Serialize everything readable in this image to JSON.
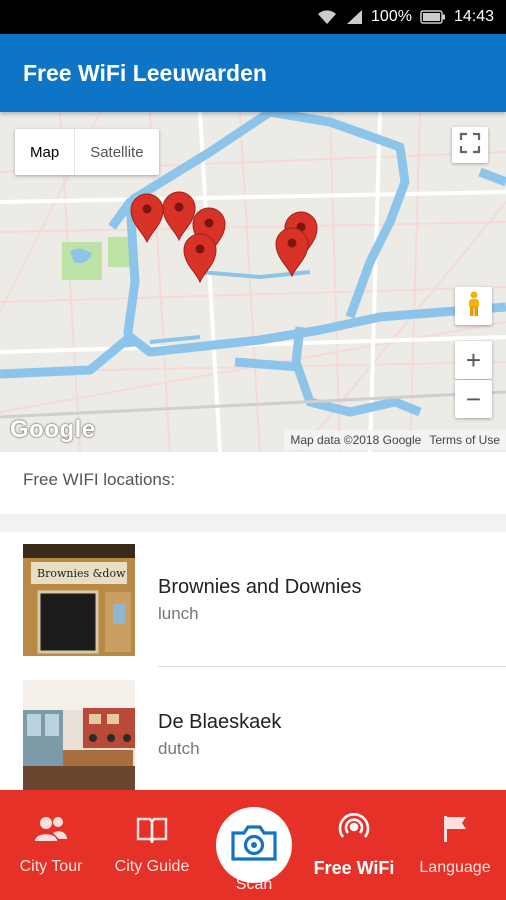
{
  "status_bar": {
    "battery": "100%",
    "time": "14:43",
    "icons": [
      "wifi-icon",
      "signal-icon",
      "battery-icon"
    ]
  },
  "app_bar": {
    "title": "Free WiFi Leeuwarden",
    "color": "#0e74c5"
  },
  "map": {
    "type_toggle": {
      "options": [
        "Map",
        "Satellite"
      ],
      "selected": "Map"
    },
    "logo": "Google",
    "attribution": "Map data ©2018 Google",
    "terms": "Terms of Use",
    "zoom_in_label": "+",
    "zoom_out_label": "−",
    "marker_color": "#d93226"
  },
  "section": {
    "title": "Free WIFI locations:"
  },
  "locations": [
    {
      "name": "Brownies and Downies",
      "category": "lunch"
    },
    {
      "name": "De Blaeskaek",
      "category": "dutch"
    }
  ],
  "bottom_nav": {
    "color": "#e53128",
    "items": [
      {
        "label": "City Tour",
        "icon": "people-icon"
      },
      {
        "label": "City Guide",
        "icon": "book-icon"
      },
      {
        "label": "Scan",
        "icon": "camera-icon"
      },
      {
        "label": "Free WiFi",
        "icon": "wifi-signal-icon",
        "active": true
      },
      {
        "label": "Language",
        "icon": "flag-icon"
      }
    ]
  }
}
